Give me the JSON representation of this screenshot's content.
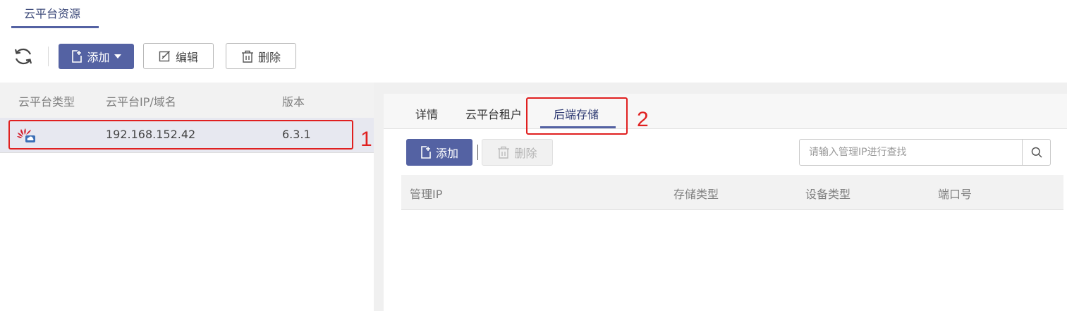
{
  "top_tab": {
    "label": "云平台资源"
  },
  "toolbar": {
    "refresh_icon": "refresh-icon",
    "add_label": "添加",
    "edit_label": "编辑",
    "delete_label": "删除"
  },
  "left_table": {
    "columns": [
      "云平台类型",
      "云平台IP/域名",
      "版本"
    ],
    "rows": [
      {
        "type_icon": "huawei-cloud-icon",
        "ip": "192.168.152.42",
        "version": "6.3.1"
      }
    ]
  },
  "right_panel": {
    "tabs": [
      "详情",
      "云平台租户",
      "后端存储"
    ],
    "active_tab": "后端存储",
    "add_label": "添加",
    "delete_label": "删除",
    "search": {
      "placeholder": "请输入管理IP进行查找",
      "value": ""
    },
    "table_columns": [
      "管理IP",
      "存储类型",
      "设备类型",
      "端口号"
    ]
  },
  "annotations": {
    "box1": "1",
    "box2": "2"
  },
  "colors": {
    "primary": "#5462a3",
    "annotation": "#e02020",
    "selected_row": "#e7e8f0"
  }
}
